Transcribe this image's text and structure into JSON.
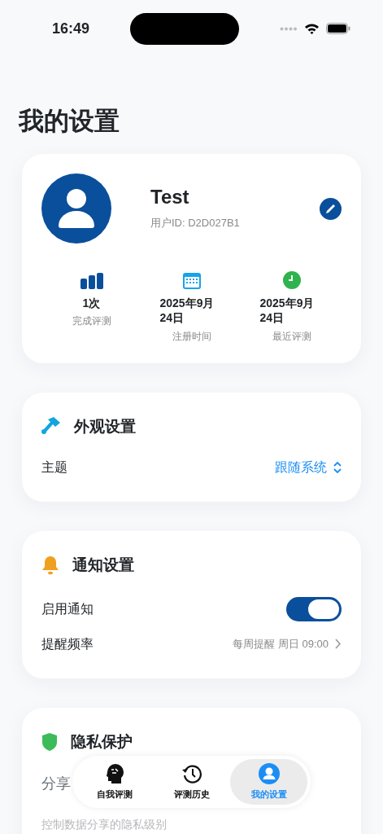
{
  "status_bar": {
    "time": "16:49"
  },
  "title": "我的设置",
  "profile": {
    "name": "Test",
    "user_id": "用户ID: D2D027B1",
    "stats": [
      {
        "value": "1次",
        "label": "完成评测"
      },
      {
        "value": "2025年9月24日",
        "label": "注册时间"
      },
      {
        "value": "2025年9月24日",
        "label": "最近评测"
      }
    ]
  },
  "sections": [
    {
      "title": "外观设置",
      "rows": [
        {
          "kind": "picker",
          "label": "主题",
          "value": "跟随系统"
        }
      ]
    },
    {
      "title": "通知设置",
      "rows": [
        {
          "kind": "toggle",
          "label": "启用通知",
          "on": true
        },
        {
          "kind": "link",
          "label": "提醒频率",
          "value": "每周提醒 周日 09:00"
        }
      ]
    },
    {
      "title": "隐私保护",
      "rows": [
        {
          "kind": "text",
          "label": "分享",
          "subtitle": "控制数据分享的隐私级别"
        }
      ]
    }
  ],
  "tabs": [
    {
      "label": "自我评测",
      "selected": false
    },
    {
      "label": "评测历史",
      "selected": false
    },
    {
      "label": "我的设置",
      "selected": true
    }
  ]
}
